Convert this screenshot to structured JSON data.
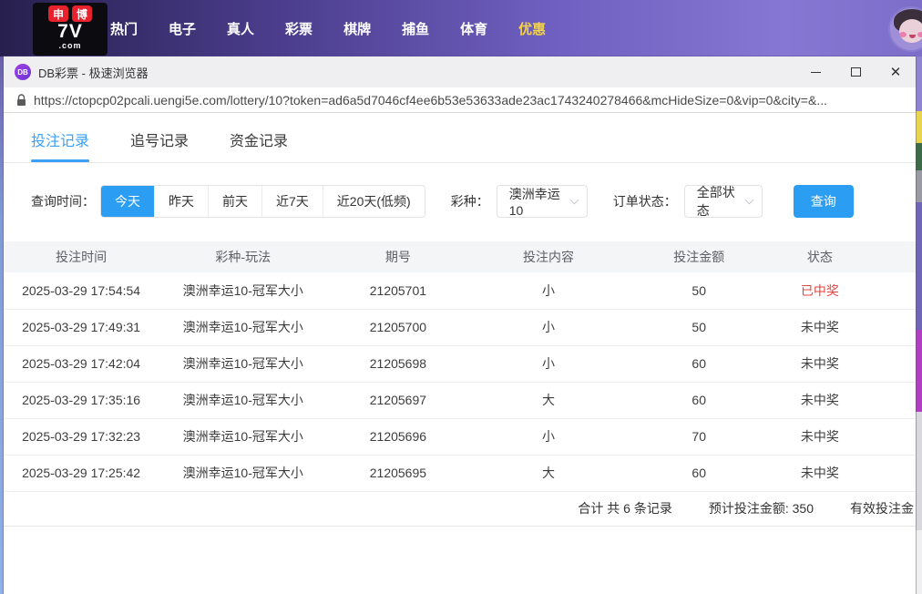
{
  "site_header": {
    "logo": {
      "badge1": "申",
      "badge2": "博",
      "main": "7V",
      "sub": ".com"
    },
    "nav": [
      {
        "label": "热门"
      },
      {
        "label": "电子"
      },
      {
        "label": "真人"
      },
      {
        "label": "彩票"
      },
      {
        "label": "棋牌"
      },
      {
        "label": "捕鱼"
      },
      {
        "label": "体育"
      },
      {
        "label": "优惠",
        "highlight": true
      }
    ]
  },
  "browser": {
    "title": "DB彩票 - 极速浏览器",
    "favicon_text": "DB",
    "url": "https://ctopcp02pcali.uengi5e.com/lottery/10?token=ad6a5d7046cf4ee6b53e53633ade23ac1743240278466&mcHideSize=0&vip=0&city=&...",
    "icons": {
      "close": "✕"
    }
  },
  "page": {
    "tabs": [
      {
        "label": "投注记录",
        "active": true
      },
      {
        "label": "追号记录",
        "active": false
      },
      {
        "label": "资金记录",
        "active": false
      }
    ],
    "filters": {
      "time_label": "查询时间：",
      "time_options": [
        {
          "label": "今天",
          "active": true
        },
        {
          "label": "昨天",
          "active": false
        },
        {
          "label": "前天",
          "active": false
        },
        {
          "label": "近7天",
          "active": false
        },
        {
          "label": "近20天(低频)",
          "active": false
        }
      ],
      "lottery_label": "彩种：",
      "lottery_value": "澳洲幸运10",
      "status_label": "订单状态：",
      "status_value": "全部状态",
      "search_button": "查询"
    },
    "table": {
      "columns": [
        "投注时间",
        "彩种-玩法",
        "期号",
        "投注内容",
        "投注金额",
        "状态"
      ],
      "rows": [
        {
          "time": "2025-03-29 17:54:54",
          "game": "澳洲幸运10-冠军大小",
          "issue": "21205701",
          "content": "小",
          "amount": "50",
          "status": "已中奖",
          "won": true
        },
        {
          "time": "2025-03-29 17:49:31",
          "game": "澳洲幸运10-冠军大小",
          "issue": "21205700",
          "content": "小",
          "amount": "50",
          "status": "未中奖",
          "won": false
        },
        {
          "time": "2025-03-29 17:42:04",
          "game": "澳洲幸运10-冠军大小",
          "issue": "21205698",
          "content": "小",
          "amount": "60",
          "status": "未中奖",
          "won": false
        },
        {
          "time": "2025-03-29 17:35:16",
          "game": "澳洲幸运10-冠军大小",
          "issue": "21205697",
          "content": "大",
          "amount": "60",
          "status": "未中奖",
          "won": false
        },
        {
          "time": "2025-03-29 17:32:23",
          "game": "澳洲幸运10-冠军大小",
          "issue": "21205696",
          "content": "小",
          "amount": "70",
          "status": "未中奖",
          "won": false
        },
        {
          "time": "2025-03-29 17:25:42",
          "game": "澳洲幸运10-冠军大小",
          "issue": "21205695",
          "content": "大",
          "amount": "60",
          "status": "未中奖",
          "won": false
        }
      ]
    },
    "summary": {
      "total": "合计 共 6 条记录",
      "expected": "预计投注金额: 350",
      "valid_clipped": "有效投注金"
    },
    "colors": {
      "accent": "#2b9ef3",
      "win_red": "#e2453e",
      "nav_highlight": "#f2d24b"
    }
  }
}
